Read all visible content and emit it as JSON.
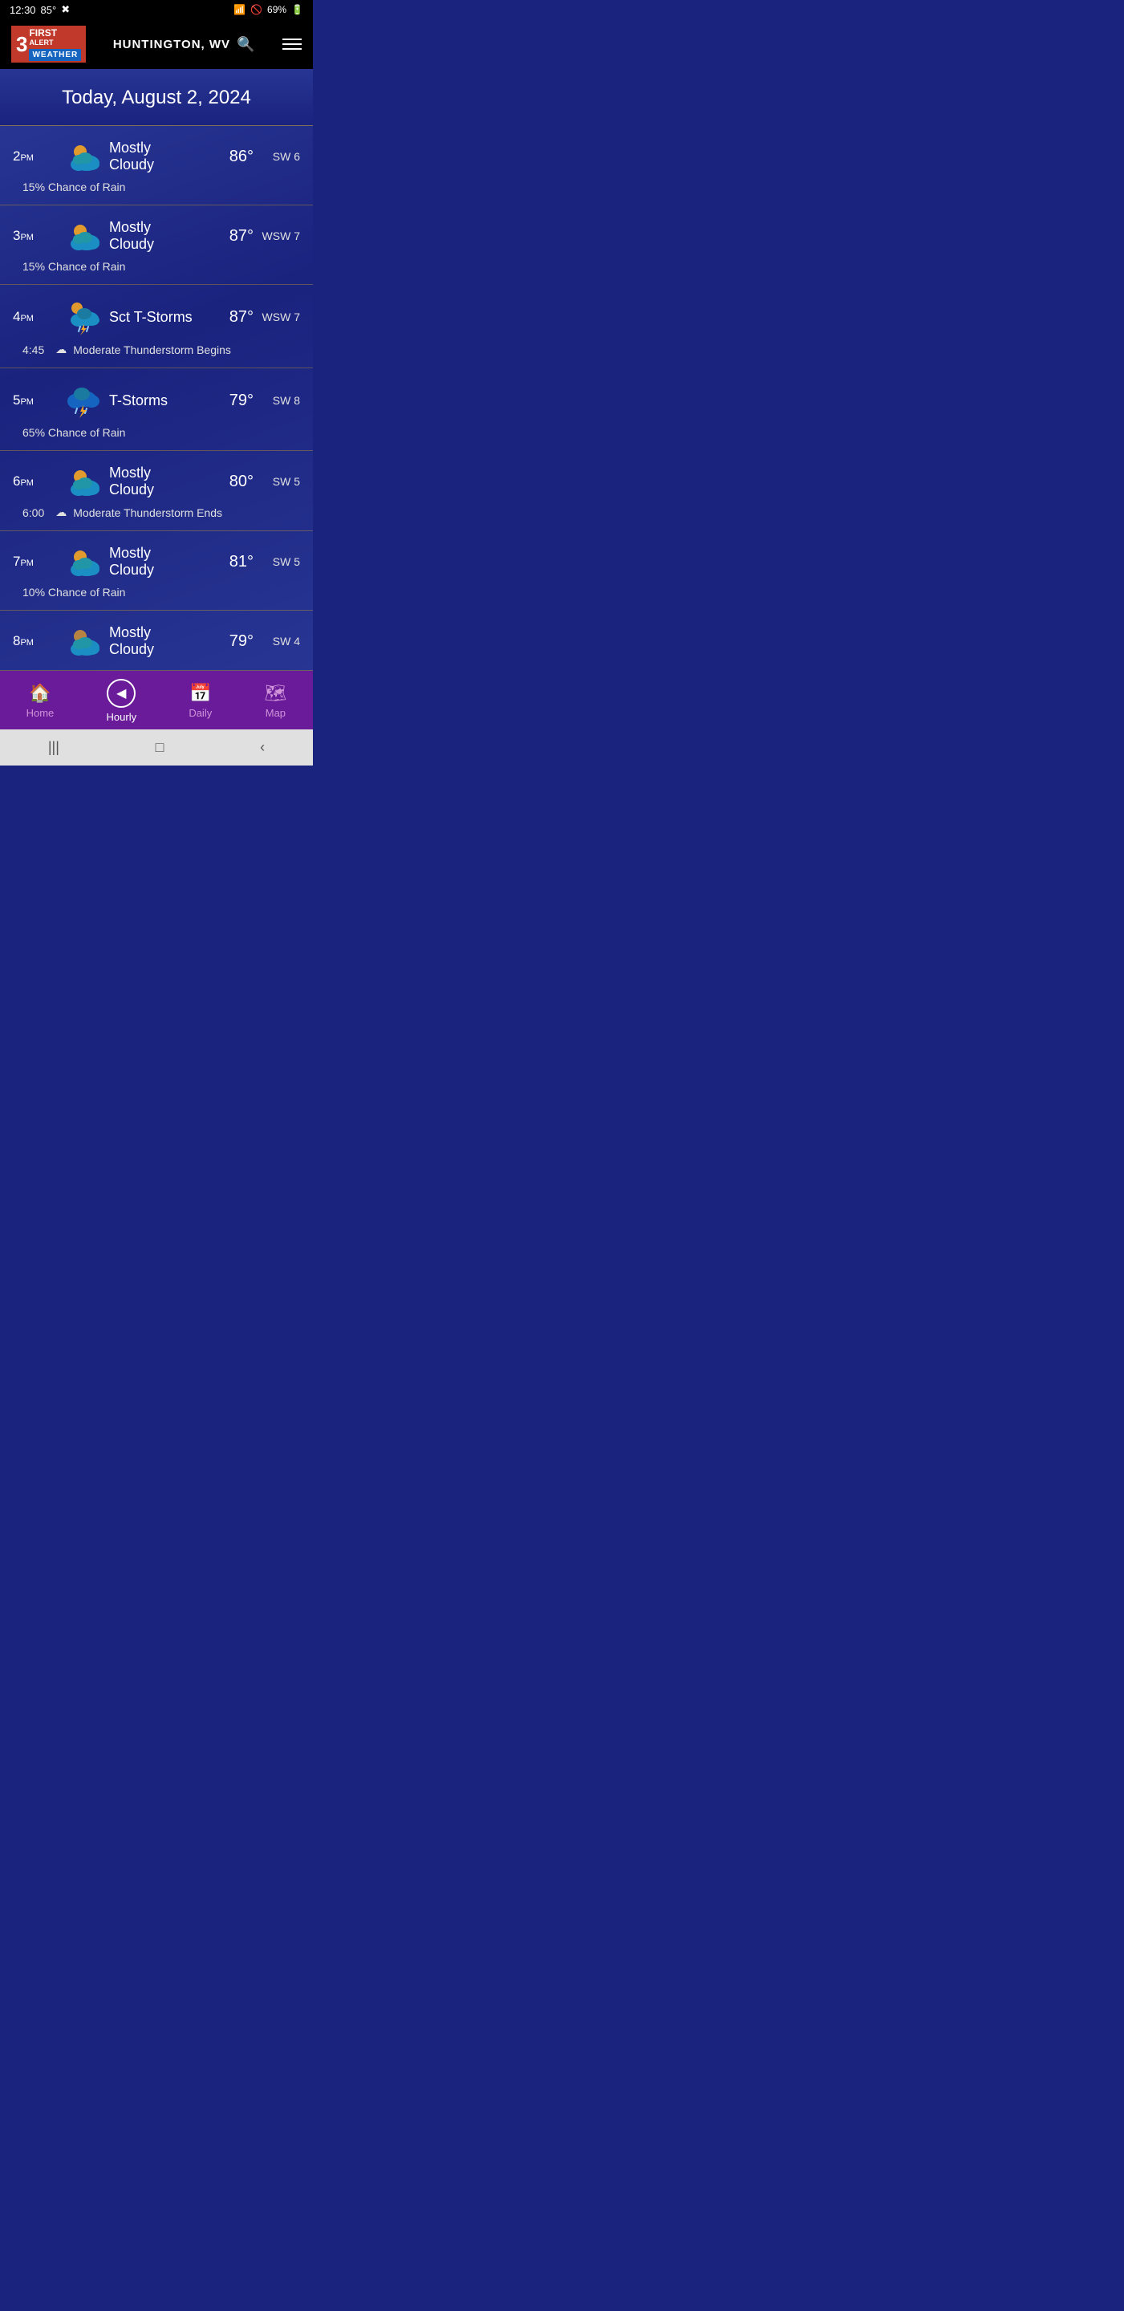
{
  "statusBar": {
    "time": "12:30",
    "temp": "85°",
    "battery": "69%"
  },
  "header": {
    "logoNum": "3",
    "logoFirst": "FIRST",
    "logoAlert": "ALERT",
    "logoWeather": "WEATHER",
    "location": "HUNTINGTON, WV",
    "menuLabel": "menu"
  },
  "dateBanner": {
    "text": "Today, August 2, 2024"
  },
  "hourlyRows": [
    {
      "hour": "2",
      "ampm": "PM",
      "condition": "Mostly Cloudy",
      "temp": "86°",
      "wind": "SW 6",
      "detail": "15% Chance of Rain",
      "detailTime": "",
      "detailIcon": "",
      "iconType": "mostly-cloudy"
    },
    {
      "hour": "3",
      "ampm": "PM",
      "condition": "Mostly Cloudy",
      "temp": "87°",
      "wind": "WSW 7",
      "detail": "15% Chance of Rain",
      "detailTime": "",
      "detailIcon": "",
      "iconType": "mostly-cloudy"
    },
    {
      "hour": "4",
      "ampm": "PM",
      "condition": "Sct T-Storms",
      "temp": "87°",
      "wind": "WSW 7",
      "detail": "Moderate Thunderstorm Begins",
      "detailTime": "4:45",
      "detailIcon": "cloud",
      "iconType": "sct-tstorm"
    },
    {
      "hour": "5",
      "ampm": "PM",
      "condition": "T-Storms",
      "temp": "79°",
      "wind": "SW 8",
      "detail": "65% Chance of Rain",
      "detailTime": "",
      "detailIcon": "",
      "iconType": "tstorm"
    },
    {
      "hour": "6",
      "ampm": "PM",
      "condition": "Mostly Cloudy",
      "temp": "80°",
      "wind": "SW 5",
      "detail": "Moderate Thunderstorm Ends",
      "detailTime": "6:00",
      "detailIcon": "cloud",
      "iconType": "mostly-cloudy"
    },
    {
      "hour": "7",
      "ampm": "PM",
      "condition": "Mostly Cloudy",
      "temp": "81°",
      "wind": "SW 5",
      "detail": "10% Chance of Rain",
      "detailTime": "",
      "detailIcon": "",
      "iconType": "mostly-cloudy"
    },
    {
      "hour": "8",
      "ampm": "PM",
      "condition": "Mostly Cloudy",
      "temp": "79°",
      "wind": "SW 4",
      "detail": "",
      "detailTime": "",
      "detailIcon": "",
      "iconType": "mostly-cloudy"
    }
  ],
  "bottomNav": {
    "items": [
      {
        "label": "Home",
        "icon": "🏠",
        "active": false
      },
      {
        "label": "Hourly",
        "icon": "◀",
        "active": true
      },
      {
        "label": "Daily",
        "icon": "📅",
        "active": false
      },
      {
        "label": "Map",
        "icon": "🗺",
        "active": false
      }
    ]
  },
  "sysNav": {
    "buttons": [
      "|||",
      "□",
      "‹"
    ]
  }
}
